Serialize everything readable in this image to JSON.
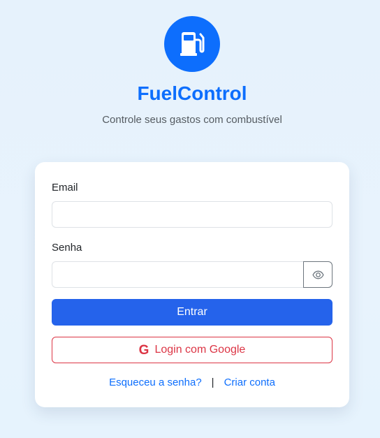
{
  "app": {
    "name": "FuelControl",
    "tagline": "Controle seus gastos com combustível",
    "logo_icon": "fuel-pump-icon"
  },
  "form": {
    "email_label": "Email",
    "email_value": "",
    "password_label": "Senha",
    "password_value": "",
    "toggle_icon": "eye-icon",
    "submit_label": "Entrar",
    "google_label": "Login com Google",
    "google_icon": "google-icon"
  },
  "links": {
    "forgot": "Esqueceu a senha?",
    "separator": "|",
    "register": "Criar conta"
  },
  "colors": {
    "primary": "#0d6efd",
    "submit": "#2563eb",
    "google": "#dc3545",
    "background": "#e6f2fc"
  }
}
